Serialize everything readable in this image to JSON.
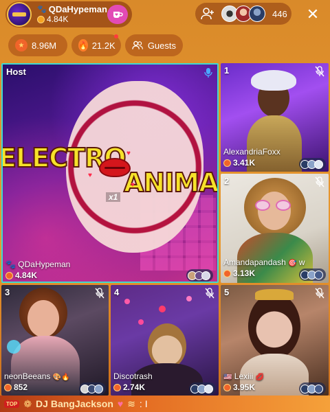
{
  "header": {
    "host_name": "QDaHypeman",
    "host_score": "4.84K",
    "viewer_count": "446"
  },
  "stats": {
    "stars": "8.96M",
    "flames": "21.2K",
    "guests_label": "Guests"
  },
  "host_tile": {
    "label": "Host",
    "name": "QDaHypeman",
    "score": "4.84K",
    "overlay_text_1": "ELECTRO",
    "overlay_text_2": "ANIMA",
    "gift_multiplier": "x1"
  },
  "guests": [
    {
      "slot": "1",
      "name": "AlexandriaFoxx",
      "score": "3.41K"
    },
    {
      "slot": "2",
      "name": "Amandapandash",
      "name_suffix": "w",
      "score": "3.13K"
    },
    {
      "slot": "3",
      "name": "neonBeeans",
      "score": "852"
    },
    {
      "slot": "4",
      "name": "Discotrash",
      "score": "2.74K"
    },
    {
      "slot": "5",
      "name": "Lexiii",
      "score": "3.95K"
    }
  ],
  "banner": {
    "top_badge": "TOP",
    "name": "DJ BangJackson",
    "suffix": ": I"
  },
  "colors": {
    "host_border": "#3fd9d0",
    "accent_pink": "#e24bb6",
    "star_orange": "#f0642a"
  }
}
